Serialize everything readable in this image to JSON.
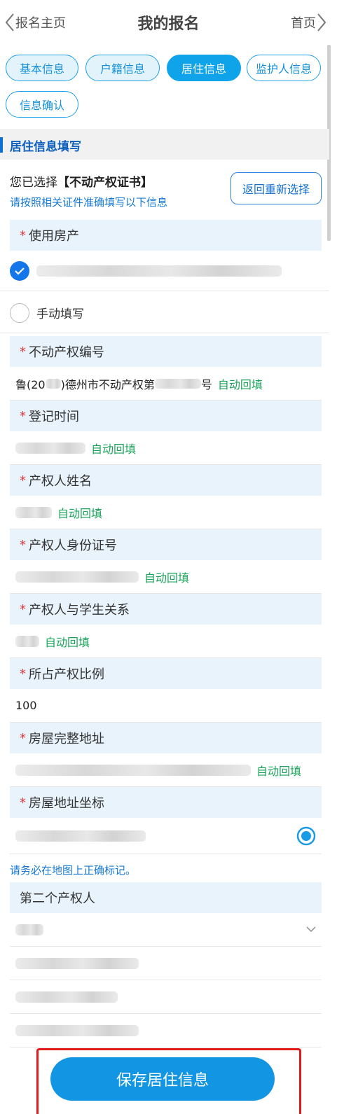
{
  "header": {
    "back_label": "报名主页",
    "title": "我的报名",
    "home_label": "首页"
  },
  "tabs": [
    {
      "label": "基本信息",
      "state": "done"
    },
    {
      "label": "户籍信息",
      "state": "done"
    },
    {
      "label": "居住信息",
      "state": "active"
    },
    {
      "label": "监护人信息",
      "state": "plain"
    },
    {
      "label": "信息确认",
      "state": "plain"
    }
  ],
  "section": {
    "title": "居住信息填写"
  },
  "selection": {
    "prefix": "您已选择",
    "choice": "【不动产权证书】",
    "hint": "请按照相关证件准确填写以下信息",
    "reselect_label": "返回重新选择"
  },
  "property": {
    "label": "使用房产",
    "manual_label": "手动填写"
  },
  "auto_fill_text": "自动回填",
  "fields": {
    "cert_no": {
      "label": "不动产权编号",
      "value_prefix": "鲁(20",
      "value_mid": ")德州市不动产权第",
      "value_suffix": "号"
    },
    "reg_time": {
      "label": "登记时间"
    },
    "owner_name": {
      "label": "产权人姓名"
    },
    "owner_id": {
      "label": "产权人身份证号"
    },
    "relation": {
      "label": "产权人与学生关系"
    },
    "share": {
      "label": "所占产权比例",
      "value": "100"
    },
    "address": {
      "label": "房屋完整地址"
    },
    "coords": {
      "label": "房屋地址坐标",
      "hint": "请务必在地图上正确标记。"
    }
  },
  "second_owner": {
    "label": "第二个产权人"
  },
  "save_button": {
    "label": "保存居住信息"
  },
  "colors": {
    "accent": "#0fa3ea",
    "required": "#e53b3b",
    "auto_fill": "#1aa35a",
    "highlight_box": "#e21a1a"
  }
}
